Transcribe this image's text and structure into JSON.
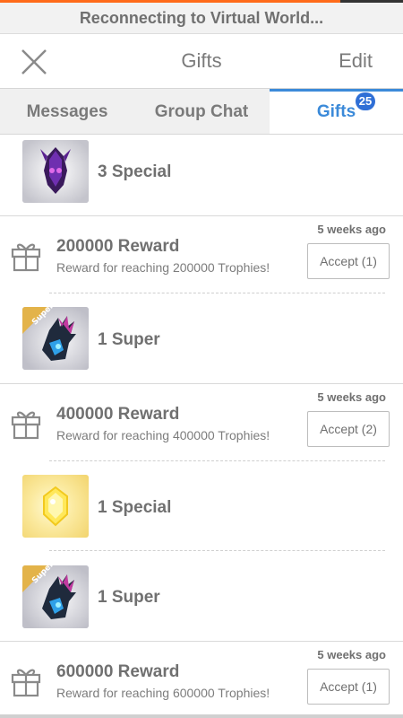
{
  "status_bar": {
    "text": "Reconnecting to Virtual World..."
  },
  "header": {
    "title": "Gifts",
    "edit_label": "Edit",
    "close_icon": "close-icon"
  },
  "tabs": [
    {
      "label": "Messages"
    },
    {
      "label": "Group Chat"
    },
    {
      "label": "Gifts",
      "badge": "25",
      "active": true
    }
  ],
  "colors": {
    "accent": "#3b8ad9",
    "badge": "#2f6fd6",
    "topbar": "#ff6b1a"
  },
  "items": [
    {
      "type": "item",
      "label": "3 Special",
      "icon": "purple-dragon-head"
    },
    {
      "type": "reward",
      "title": "200000 Reward",
      "description": "Reward for reaching 200000 Trophies!",
      "time": "5 weeks ago",
      "accept": "Accept (1)",
      "icon": "gift-icon"
    },
    {
      "type": "item",
      "label": "1 Super",
      "icon": "blue-dragon-head",
      "ribbon": "Super"
    },
    {
      "type": "reward",
      "title": "400000 Reward",
      "description": "Reward for reaching 400000 Trophies!",
      "time": "5 weeks ago",
      "accept": "Accept (2)",
      "icon": "gift-icon"
    },
    {
      "type": "item",
      "label": "1 Special",
      "icon": "gold-gem"
    },
    {
      "type": "item",
      "label": "1 Super",
      "icon": "blue-dragon-head",
      "ribbon": "Super"
    },
    {
      "type": "reward",
      "title": "600000 Reward",
      "description": "Reward for reaching 600000 Trophies!",
      "time": "5 weeks ago",
      "accept": "Accept (1)",
      "icon": "gift-icon"
    }
  ]
}
